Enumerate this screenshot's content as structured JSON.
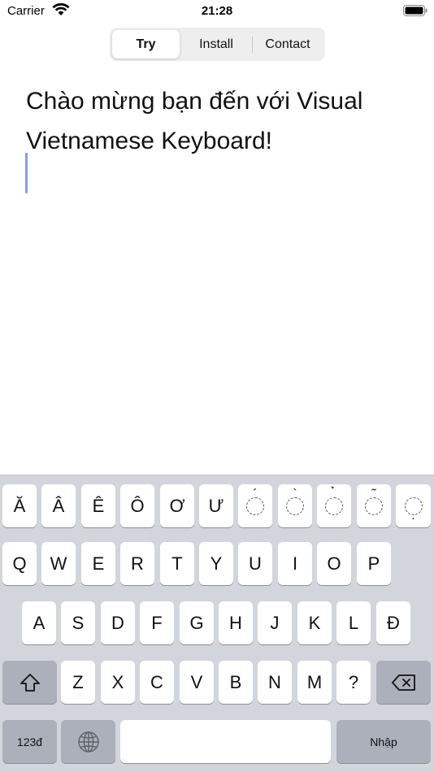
{
  "status_bar": {
    "carrier": "Carrier",
    "time": "21:28"
  },
  "tabs": [
    {
      "label": "Try",
      "selected": true
    },
    {
      "label": "Install",
      "selected": false
    },
    {
      "label": "Contact",
      "selected": false
    }
  ],
  "editor": {
    "line1": "Chào mừng bạn đến với Visual",
    "line2": "Vietnamese Keyboard!"
  },
  "keyboard": {
    "row_vowels": [
      "Ă",
      "Â",
      "Ê",
      "Ô",
      "Ơ",
      "Ư"
    ],
    "tone_marks": [
      {
        "name": "acute",
        "mark": "´",
        "position": "top"
      },
      {
        "name": "grave",
        "mark": "`",
        "position": "top"
      },
      {
        "name": "hook",
        "mark": "̉",
        "position": "top"
      },
      {
        "name": "tilde",
        "mark": "˜",
        "position": "top"
      },
      {
        "name": "dot-below",
        "mark": ".",
        "position": "bottom"
      }
    ],
    "row1": [
      "Q",
      "W",
      "E",
      "R",
      "T",
      "Y",
      "U",
      "I",
      "O",
      "P"
    ],
    "row2": [
      "A",
      "S",
      "D",
      "F",
      "G",
      "H",
      "J",
      "K",
      "L",
      "Đ"
    ],
    "row3": [
      "Z",
      "X",
      "C",
      "V",
      "B",
      "N",
      "M",
      "?"
    ],
    "numbers_label": "123đ",
    "return_label": "Nhập",
    "icons": {
      "shift": "shift-icon",
      "delete": "delete-icon",
      "globe": "globe-icon"
    }
  },
  "colors": {
    "keyboard_bg": "#d2d5db",
    "special_key": "#abb0ba",
    "caret": "#8a9fe6"
  }
}
